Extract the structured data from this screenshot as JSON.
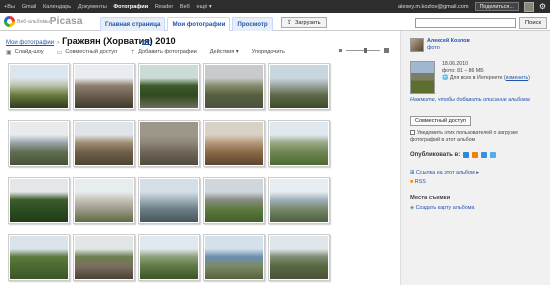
{
  "topbar": {
    "items": [
      "+Вы",
      "Gmail",
      "Календарь",
      "Документы",
      "Фотографии",
      "Reader",
      "Веб",
      "ещё ▾"
    ],
    "active_index": 4,
    "email": "alexey.m.kozlov@gmail.com",
    "share_label": "Поделиться..."
  },
  "logo": {
    "prefix": "Веб-альбомы",
    "name": "Picasa"
  },
  "tabs": [
    "Главная страница",
    "Мои фотографии",
    "Просмотр"
  ],
  "selected_tab": 1,
  "upload_label": "Загрузить",
  "search": {
    "value": "",
    "button_label": "Поиск"
  },
  "breadcrumb": {
    "parent": "Мои фотографии",
    "separator": "›",
    "title": "Гражвян (Хорватия) 2010"
  },
  "edit_label": "edit",
  "toolbar": {
    "slideshow": "Слайд-шоу",
    "share": "Совместный доступ",
    "add_photos": "Добавить фотографии",
    "actions": "Действия ▾",
    "sort": "Упорядочить"
  },
  "photos": [
    {
      "colors": [
        "#dbe6ef",
        "#b9c1a6",
        "#6b7a3e",
        "#2f3a1f"
      ]
    },
    {
      "colors": [
        "#e9edf2",
        "#8c7f6e",
        "#6c5f4f",
        "#3e3a2c"
      ]
    },
    {
      "colors": [
        "#cbdcd7",
        "#3f5a2a",
        "#2f4a20",
        "#6c6c5a"
      ]
    },
    {
      "colors": [
        "#c9cacb",
        "#868c6e",
        "#54603d",
        "#4d4f41"
      ]
    },
    {
      "colors": [
        "#c8d7dd",
        "#9da4a0",
        "#5d6a4a",
        "#3e4b2b"
      ]
    },
    {
      "colors": [
        "#e8eaec",
        "#99a5ad",
        "#5f6e50",
        "#465236"
      ]
    },
    {
      "colors": [
        "#dfe4e8",
        "#a08e73",
        "#6f5f4a",
        "#4e4334"
      ]
    },
    {
      "colors": [
        "#9d978a",
        "#8e8676",
        "#6e6657",
        "#514a3d"
      ]
    },
    {
      "colors": [
        "#d8d1c6",
        "#b59a7b",
        "#8a6a46",
        "#5b4432"
      ]
    },
    {
      "colors": [
        "#dfe8ee",
        "#9aa986",
        "#6f8552",
        "#4d6a33"
      ]
    },
    {
      "colors": [
        "#e4e7ea",
        "#3e5c2c",
        "#2e4f22",
        "#1f3a18"
      ]
    },
    {
      "colors": [
        "#e7ecef",
        "#c6c3b7",
        "#9e9b8c",
        "#5d6a3e"
      ]
    },
    {
      "colors": [
        "#d4dee6",
        "#a3b3bd",
        "#6c7e86",
        "#48555c"
      ]
    },
    {
      "colors": [
        "#cfd6dc",
        "#8a8d86",
        "#5d7a3e",
        "#41602b"
      ]
    },
    {
      "colors": [
        "#e6edf1",
        "#9fb0bb",
        "#77886b",
        "#4f5e3f"
      ]
    },
    {
      "colors": [
        "#d9e3e9",
        "#5d7a3e",
        "#4b6a30",
        "#3a5627"
      ]
    },
    {
      "colors": [
        "#e2e6e6",
        "#6c8050",
        "#7a6f5f",
        "#4a4134"
      ]
    },
    {
      "colors": [
        "#dfe8ee",
        "#8ca27a",
        "#5f7a45",
        "#3b5329"
      ]
    },
    {
      "colors": [
        "#d4e0ea",
        "#6c8fb2",
        "#7b8a66",
        "#56623d"
      ]
    },
    {
      "colors": [
        "#e0e6ea",
        "#7f8f76",
        "#58683f",
        "#4a4f3c"
      ]
    }
  ],
  "sidebar": {
    "owner_name": "Алексей Козлов",
    "owner_link": "фото",
    "date": "18.06.2010",
    "photo_count": "фото: 81 – 86 МБ",
    "visibility": "Для всех в Интернете",
    "visibility_change": "изменить",
    "add_description": "Нажмите, чтобы добавить описание альбома",
    "share_button": "Совместный доступ",
    "notify_text": "Уведомить этих пользователей о загрузке фотографий в этот альбом",
    "publish_label": "Опубликовать в:",
    "publish_icons": [
      {
        "name": "buzz-icon",
        "color": "#2a8ad5"
      },
      {
        "name": "blogger-icon",
        "color": "#f57d00"
      },
      {
        "name": "share-icon",
        "color": "#3b8de3"
      },
      {
        "name": "twitter-icon",
        "color": "#55acee"
      }
    ],
    "album_link": "Ссылка на этот альбом",
    "rss": "RSS",
    "places_title": "Места съемки",
    "create_map": "Создать карту альбома"
  }
}
